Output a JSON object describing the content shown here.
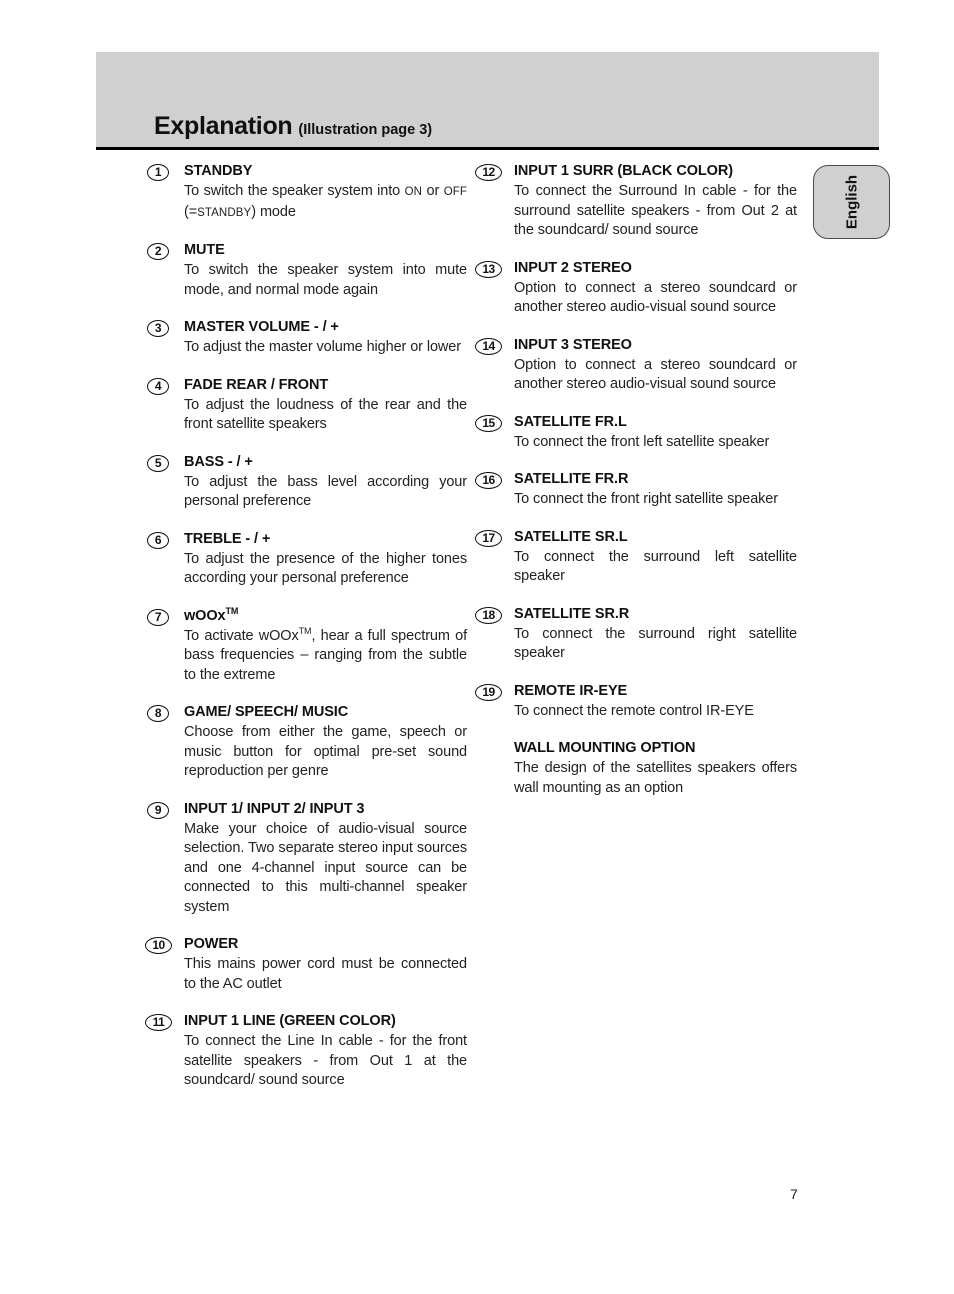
{
  "header": {
    "title": "Explanation",
    "subtitle": "(Illustration page 3)",
    "band_color": "#d0d0d0",
    "rule_color": "#000000"
  },
  "language_tab": {
    "label": "English",
    "background_color": "#d0d0d0",
    "border_color": "#4a4a4a"
  },
  "left_column": [
    {
      "marker": "1",
      "title": "STANDBY",
      "body_html": "To switch the speaker system into <span class=\"sc\">ON</span> or <span class=\"sc\">OFF</span> (=<span class=\"sc\">STANDBY</span>) mode",
      "body_text": "To switch the speaker system into ON or OFF (=STANDBY) mode"
    },
    {
      "marker": "2",
      "title": "MUTE",
      "body_html": "To switch the speaker system into mute mode, and normal mode again",
      "body_text": "To switch the speaker system into mute mode, and normal mode again"
    },
    {
      "marker": "3",
      "title": "MASTER VOLUME - / +",
      "body_html": "To adjust the master volume higher or lower",
      "body_text": "To adjust the master volume higher or lower"
    },
    {
      "marker": "4",
      "title": "FADE REAR / FRONT",
      "body_html": "To adjust the loudness of the rear and the front satellite speakers",
      "body_text": "To adjust the loudness of the rear and the front satellite speakers"
    },
    {
      "marker": "5",
      "title": "BASS - / +",
      "body_html": "To adjust the bass level according your personal preference",
      "body_text": "To adjust the bass level according your personal preference"
    },
    {
      "marker": "6",
      "title": "TREBLE - / +",
      "body_html": "To adjust the presence of the higher tones according your personal preference",
      "body_text": "To adjust the presence of the higher tones according your personal preference"
    },
    {
      "marker": "7",
      "title_html": "wOOx<sup>TM</sup>",
      "title": "wOOxTM",
      "body_html": "To activate wOOx<sup>TM</sup>, hear a full spectrum of bass frequencies &ndash; ranging from the subtle to the extreme",
      "body_text": "To activate wOOxTM, hear a full spectrum of bass frequencies – ranging from the subtle to the extreme"
    },
    {
      "marker": "8",
      "title": "GAME/ SPEECH/ MUSIC",
      "body_html": "Choose from either the game, speech or music button for optimal pre-set sound reproduction per genre",
      "body_text": "Choose from either the game, speech or music button for optimal pre-set sound reproduction per genre"
    },
    {
      "marker": "9",
      "title": "INPUT 1/ INPUT 2/ INPUT 3",
      "body_html": "Make your choice of audio-visual source selection. Two separate stereo input sources and one 4-channel input source can be connected to this multi-channel speaker system",
      "body_text": "Make your choice of audio-visual source selection. Two separate stereo input sources and one 4-channel input source can be connected to this multi-channel speaker system"
    },
    {
      "marker": "10",
      "title": "POWER",
      "body_html": "This mains power cord must be connected to the AC outlet",
      "body_text": "This mains power cord must be connected to the AC outlet"
    },
    {
      "marker": "11",
      "title": "INPUT 1 LINE (GREEN COLOR)",
      "body_html": "To connect the Line In cable - for the front satellite speakers - from Out 1 at the soundcard/ sound source",
      "body_text": "To connect the Line In cable - for the front satellite speakers - from Out 1 at the soundcard/ sound source"
    }
  ],
  "right_column": [
    {
      "marker": "12",
      "title": "INPUT 1 SURR (BLACK COLOR)",
      "body_html": "To connect the Surround In cable - for the surround satellite speakers - from Out 2 at the soundcard/ sound source",
      "body_text": "To connect the Surround In cable - for the surround satellite speakers - from Out 2 at the soundcard/ sound source"
    },
    {
      "marker": "13",
      "title": "INPUT 2 STEREO",
      "body_html": "Option to connect a stereo soundcard or another stereo audio-visual sound source",
      "body_text": "Option to connect a stereo soundcard or another stereo audio-visual sound source"
    },
    {
      "marker": "14",
      "title": "INPUT 3 STEREO",
      "body_html": "Option to connect a stereo soundcard or another stereo audio-visual sound source",
      "body_text": "Option to connect a stereo soundcard or another stereo audio-visual sound source"
    },
    {
      "marker": "15",
      "title": "SATELLITE FR.L",
      "body_html": "To connect the front left satellite speaker",
      "body_text": "To connect the front left satellite speaker"
    },
    {
      "marker": "16",
      "title": "SATELLITE FR.R",
      "body_html": "To connect the front right satellite speaker",
      "body_text": "To connect the front right satellite speaker"
    },
    {
      "marker": "17",
      "title": "SATELLITE SR.L",
      "body_html": "To connect the surround left satellite speaker",
      "body_text": "To connect the surround left satellite speaker"
    },
    {
      "marker": "18",
      "title": "SATELLITE SR.R",
      "body_html": "To connect the surround right satellite speaker",
      "body_text": "To connect the surround right satellite speaker"
    },
    {
      "marker": "19",
      "title": "REMOTE IR-EYE",
      "body_html": "To connect the remote control IR-EYE",
      "body_text": "To connect the remote control IR-EYE"
    },
    {
      "marker": "",
      "title": "WALL MOUNTING OPTION",
      "body_html": "The design of the satellites speakers offers wall mounting as an option",
      "body_text": "The design of the satellites speakers offers wall mounting as an option"
    }
  ],
  "footer": {
    "page_number": "7"
  }
}
